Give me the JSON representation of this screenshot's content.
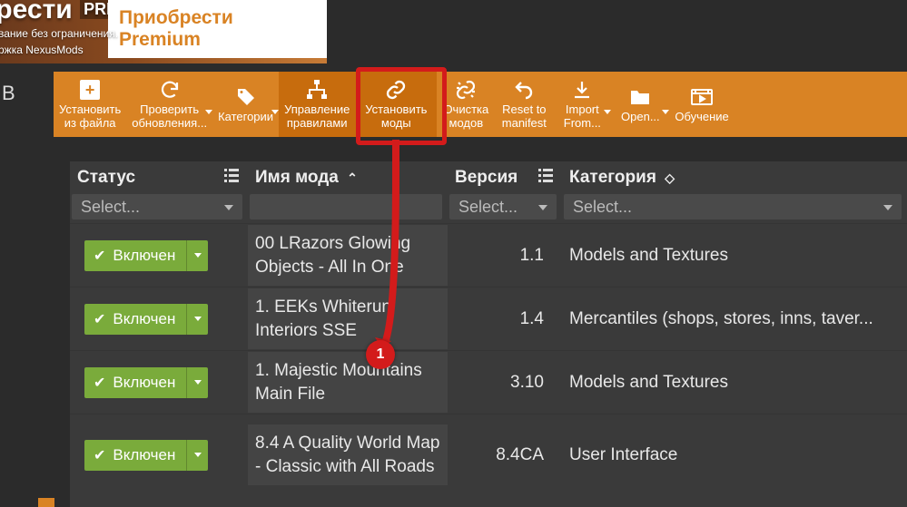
{
  "promo": {
    "big_fragment": "иобрести",
    "premium_badge_fragment": "PREMIUM",
    "button_text": "Приобрести Premium",
    "sub1": "вание без ограничения.",
    "sub2": "ржка NexusMods"
  },
  "side_fragment": "В",
  "toolbar": {
    "install_file": {
      "line1": "Установить",
      "line2": "из файла"
    },
    "check_updates": {
      "line1": "Проверить",
      "line2": "обновления..."
    },
    "categories": "Категории",
    "rules": {
      "line1": "Управление",
      "line2": "правилами"
    },
    "install_mods": {
      "line1": "Установить",
      "line2": "моды"
    },
    "cleanup": {
      "line1": "Очистка",
      "line2": "модов"
    },
    "reset": {
      "line1": "Reset to",
      "line2": "manifest"
    },
    "import": {
      "line1": "Import",
      "line2": "From..."
    },
    "open": "Open...",
    "training": "Обучение"
  },
  "annotation": {
    "badge": "1"
  },
  "table": {
    "headers": {
      "status": "Статус",
      "name": "Имя мода",
      "version": "Версия",
      "category": "Категория"
    },
    "filters": {
      "status_placeholder": "Select...",
      "version_placeholder": "Select...",
      "category_placeholder": "Select..."
    },
    "status_label": "Включен",
    "rows": [
      {
        "name": "00 LRazors Glowing Objects - All In One",
        "version": "1.1",
        "category": "Models and Textures"
      },
      {
        "name": "1. EEKs Whiterun Interiors SSE",
        "version": "1.4",
        "category": "Mercantiles (shops, stores, inns, taver..."
      },
      {
        "name": "1. Majestic Mountains Main File",
        "version": "3.10",
        "category": "Models and Textures"
      },
      {
        "name": "8.4 A Quality World Map - Classic with All Roads",
        "version": "8.4CA",
        "category": "User Interface"
      }
    ]
  }
}
